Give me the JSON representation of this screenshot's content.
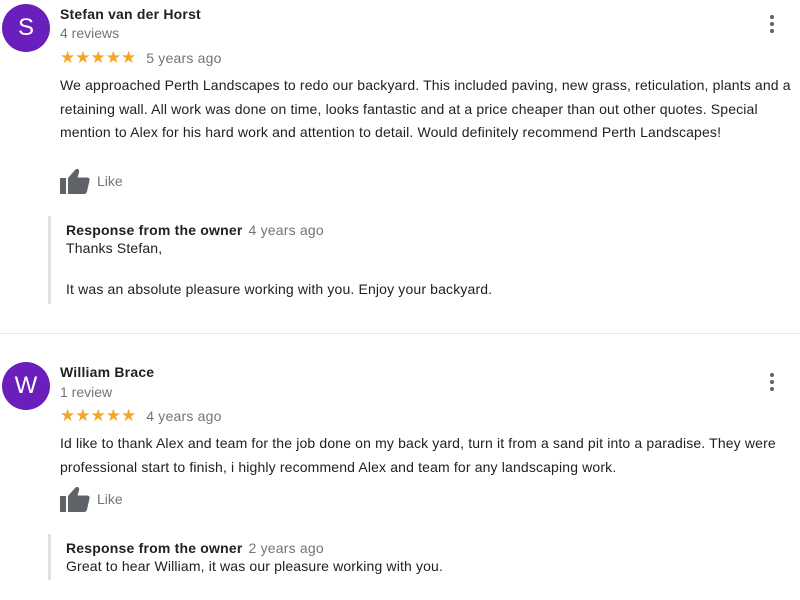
{
  "reviews": [
    {
      "avatar_letter": "S",
      "author": "Stefan van der Horst",
      "review_count": "4 reviews",
      "stars": "★★★★★",
      "rating": 5,
      "date": "5 years ago",
      "text": "We approached Perth Landscapes to redo our backyard. This included paving, new grass, reticulation, plants and a retaining wall. All work was done on time, looks fantastic and at a price cheaper than out other quotes. Special mention to Alex for his hard work and attention to detail. Would definitely recommend Perth Landscapes!",
      "like_label": "Like",
      "response": {
        "title": "Response from the owner",
        "date": "4 years ago",
        "paragraphs": [
          "Thanks Stefan,",
          "It was an absolute pleasure working with you. Enjoy your backyard."
        ]
      }
    },
    {
      "avatar_letter": "W",
      "author": "William Brace",
      "review_count": "1 review",
      "stars": "★★★★★",
      "rating": 5,
      "date": "4 years ago",
      "text": "Id like to thank Alex and team for the job done on my back yard, turn it from a sand pit into a paradise. They were professional start to finish, i highly recommend Alex and team for any landscaping work.",
      "like_label": "Like",
      "response": {
        "title": "Response from the owner",
        "date": "2 years ago",
        "paragraphs": [
          "Great to hear William, it was our pleasure working with you."
        ]
      }
    }
  ],
  "colors": {
    "avatar": "#6a1fbd",
    "star": "#f5a623",
    "muted_text": "#70757a",
    "icon": "#5f6368",
    "response_border": "#e0e0e0"
  },
  "icons": {
    "menu": "more-vert-icon",
    "like": "thumb-up-icon",
    "star": "star-icon"
  }
}
